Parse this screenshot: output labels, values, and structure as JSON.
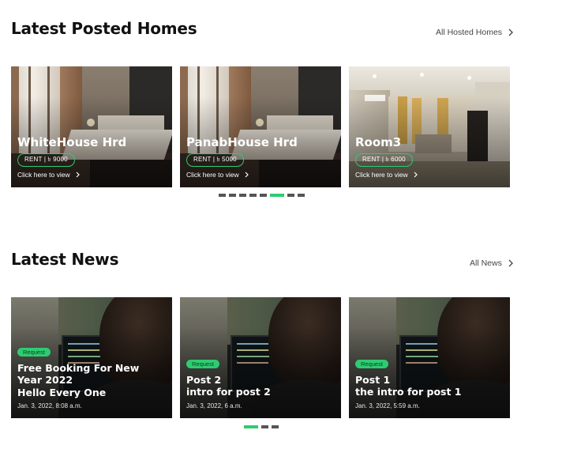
{
  "homes_section": {
    "title": "Latest Posted Homes",
    "see_all": "All Hosted Homes",
    "cards": [
      {
        "title": "WhiteHouse Hrd",
        "price": "RENT | ৳ 9000",
        "cta": "Click here to view"
      },
      {
        "title": "PanabHouse Hrd",
        "price": "RENT | ৳ 5000",
        "cta": "Click here to view"
      },
      {
        "title": "Room3",
        "price": "RENT | ৳ 6000",
        "cta": "Click here to view"
      }
    ],
    "pagination": {
      "count": 8,
      "active_index": 5
    }
  },
  "news_section": {
    "title": "Latest News",
    "see_all": "All News",
    "cards": [
      {
        "tag": "Request",
        "title_line1": "Free Booking For New Year 2022",
        "title_line2": "Hello Every One",
        "date": "Jan. 3, 2022, 8:08 a.m."
      },
      {
        "tag": "Request",
        "title_line1": "Post 2",
        "title_line2": "intro for post 2",
        "date": "Jan. 3, 2022, 6 a.m."
      },
      {
        "tag": "Request",
        "title_line1": "Post 1",
        "title_line2": "the intro for post 1",
        "date": "Jan. 3, 2022, 5:59 a.m."
      }
    ],
    "pagination": {
      "count": 3,
      "active_index": 0
    }
  },
  "colors": {
    "accent": "#2ecc71",
    "dot_inactive": "#555555",
    "text": "#111111"
  },
  "icons": {
    "see_all": "chevron-right-icon",
    "card_cta": "chevron-right-icon"
  }
}
